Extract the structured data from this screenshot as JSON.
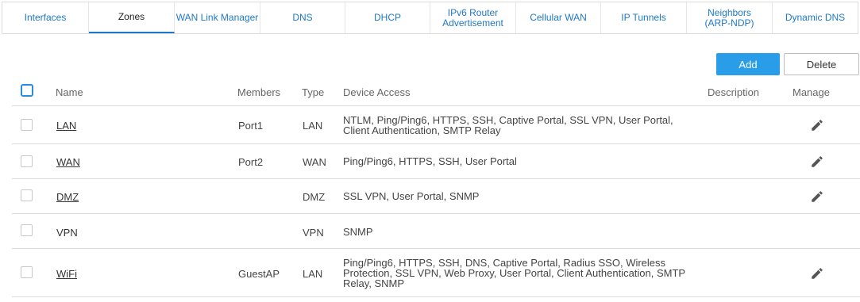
{
  "tabs": [
    {
      "label": "Interfaces"
    },
    {
      "label": "Zones"
    },
    {
      "label": "WAN Link Manager"
    },
    {
      "label": "DNS"
    },
    {
      "label": "DHCP"
    },
    {
      "label": "IPv6 Router\nAdvertisement"
    },
    {
      "label": "Cellular WAN"
    },
    {
      "label": "IP Tunnels"
    },
    {
      "label": "Neighbors\n(ARP-NDP)"
    },
    {
      "label": "Dynamic DNS"
    }
  ],
  "active_tab": "Zones",
  "toolbar": {
    "add_label": "Add",
    "delete_label": "Delete"
  },
  "columns": {
    "name": "Name",
    "members": "Members",
    "type": "Type",
    "device_access": "Device Access",
    "description": "Description",
    "manage": "Manage"
  },
  "rows": [
    {
      "name": "LAN",
      "link": true,
      "members": "Port1",
      "type": "LAN",
      "access": "NTLM, Ping/Ping6, HTTPS, SSH, Captive Portal, SSL VPN, User Portal,\nClient Authentication, SMTP Relay",
      "editable": true
    },
    {
      "name": "WAN",
      "link": true,
      "members": "Port2",
      "type": "WAN",
      "access": "Ping/Ping6, HTTPS, SSH, User Portal",
      "editable": true
    },
    {
      "name": "DMZ",
      "link": true,
      "members": "",
      "type": "DMZ",
      "access": "SSL VPN, User Portal, SNMP",
      "editable": true
    },
    {
      "name": "VPN",
      "link": false,
      "members": "",
      "type": "VPN",
      "access": "SNMP",
      "editable": false
    },
    {
      "name": "WiFi",
      "link": true,
      "members": "GuestAP",
      "type": "LAN",
      "access": "Ping/Ping6, HTTPS, SSH, DNS, Captive Portal, Radius SSO, Wireless\nProtection, SSL VPN, Web Proxy, User Portal, Client Authentication, SMTP\nRelay, SNMP",
      "editable": true
    }
  ],
  "colors": {
    "accent": "#2a9de8",
    "tab_text": "#1f78c8",
    "border": "#dcdcdc"
  },
  "icons": {
    "manage": "pencil-icon",
    "select": "checkbox-icon"
  }
}
